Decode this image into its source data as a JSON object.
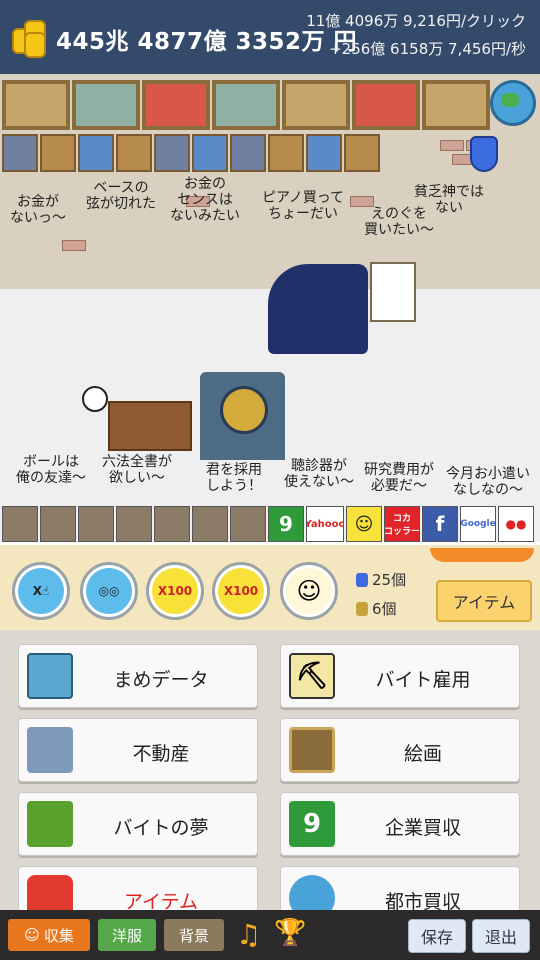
{
  "header": {
    "money_total": "445兆 4877億 3352万 円",
    "per_click": "11億 4096万 9,216円/クリック",
    "per_second": "+256億 6158万 7,456円/秒"
  },
  "scene": {
    "bubbles": [
      "お金が\nないっ〜",
      "ベースの\n弦が切れた",
      "お金の\nセンスは\nないみたい",
      "ピアノ買って\nちょーだい",
      "えのぐを\n買いたい〜",
      "貧乏神では\nない",
      "ボールは\n俺の友達〜",
      "六法全書が\n欲しい〜",
      "君を採用\nしよう！",
      "聴診器が\n使えない〜",
      "研究費用が\n必要だ〜",
      "今月お小遣い\nなしなの〜"
    ],
    "company_tiles": [
      "9",
      "Yahooo",
      "☺",
      "コカ\nコッラー",
      "f",
      "Google",
      "●●"
    ]
  },
  "toolbar": {
    "btn_x_click": "X",
    "btn_x100_click": "X100",
    "btn_x100_coin": "X100",
    "potion_count": "25個",
    "coin_count": "6個",
    "item_label": "アイテム",
    "accent": "#f58a2a"
  },
  "menu": {
    "items": [
      {
        "label": "まめデータ",
        "icon": "bag-icon"
      },
      {
        "label": "バイト雇用",
        "icon": "worker-icon"
      },
      {
        "label": "不動産",
        "icon": "building-icon"
      },
      {
        "label": "絵画",
        "icon": "painting-icon"
      },
      {
        "label": "バイトの夢",
        "icon": "dream-icon"
      },
      {
        "label": "企業買収",
        "icon": "company-icon",
        "glyph": "9"
      },
      {
        "label": "アイテム",
        "icon": "potion-icon"
      },
      {
        "label": "都市買収",
        "icon": "globe-icon"
      }
    ]
  },
  "bottom": {
    "collect": "収集",
    "clothes": "洋服",
    "background": "背景",
    "save": "保存",
    "exit": "退出"
  }
}
